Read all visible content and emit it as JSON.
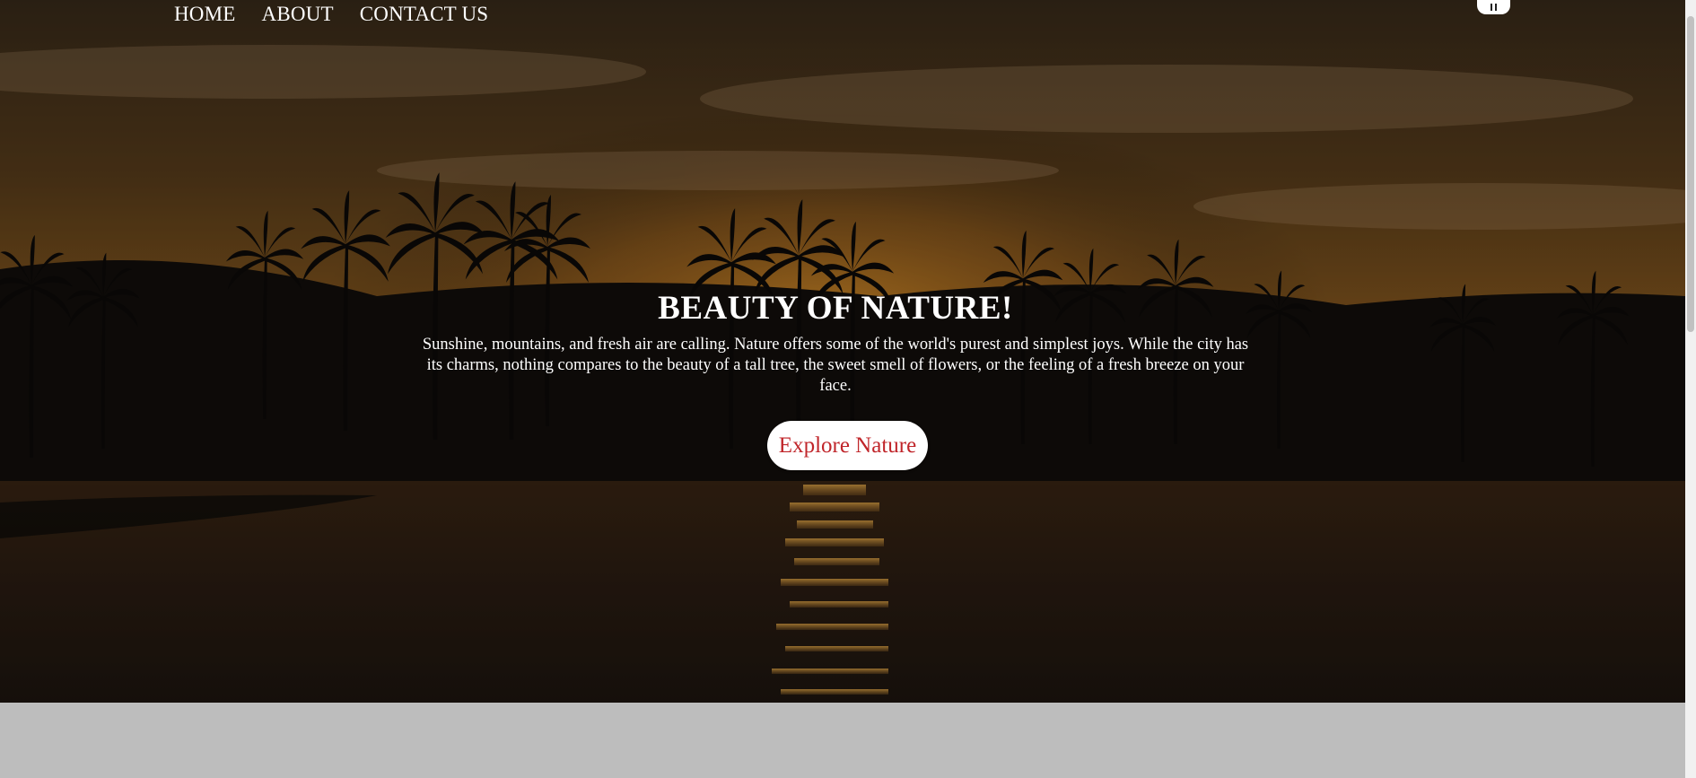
{
  "nav": {
    "items": [
      {
        "label": "HOME"
      },
      {
        "label": "ABOUT"
      },
      {
        "label": "CONTACT US"
      }
    ],
    "toggle_icon": "menu-icon"
  },
  "hero": {
    "title": "BEAUTY OF NATURE!",
    "description": "Sunshine, mountains, and fresh air are calling. Nature offers some of the world's purest and simplest joys. While the city has its charms, nothing compares to the beauty of a tall tree, the sweet smell of flowers, or the feeling of a fresh breeze on your face.",
    "cta_label": "Explore Nature",
    "background_scene": "sunset-palm-lake"
  },
  "colors": {
    "cta_text": "#c0252a",
    "cta_background": "#ffffff",
    "page_background": "#bdbdbd",
    "hero_overlay": "#000000"
  }
}
